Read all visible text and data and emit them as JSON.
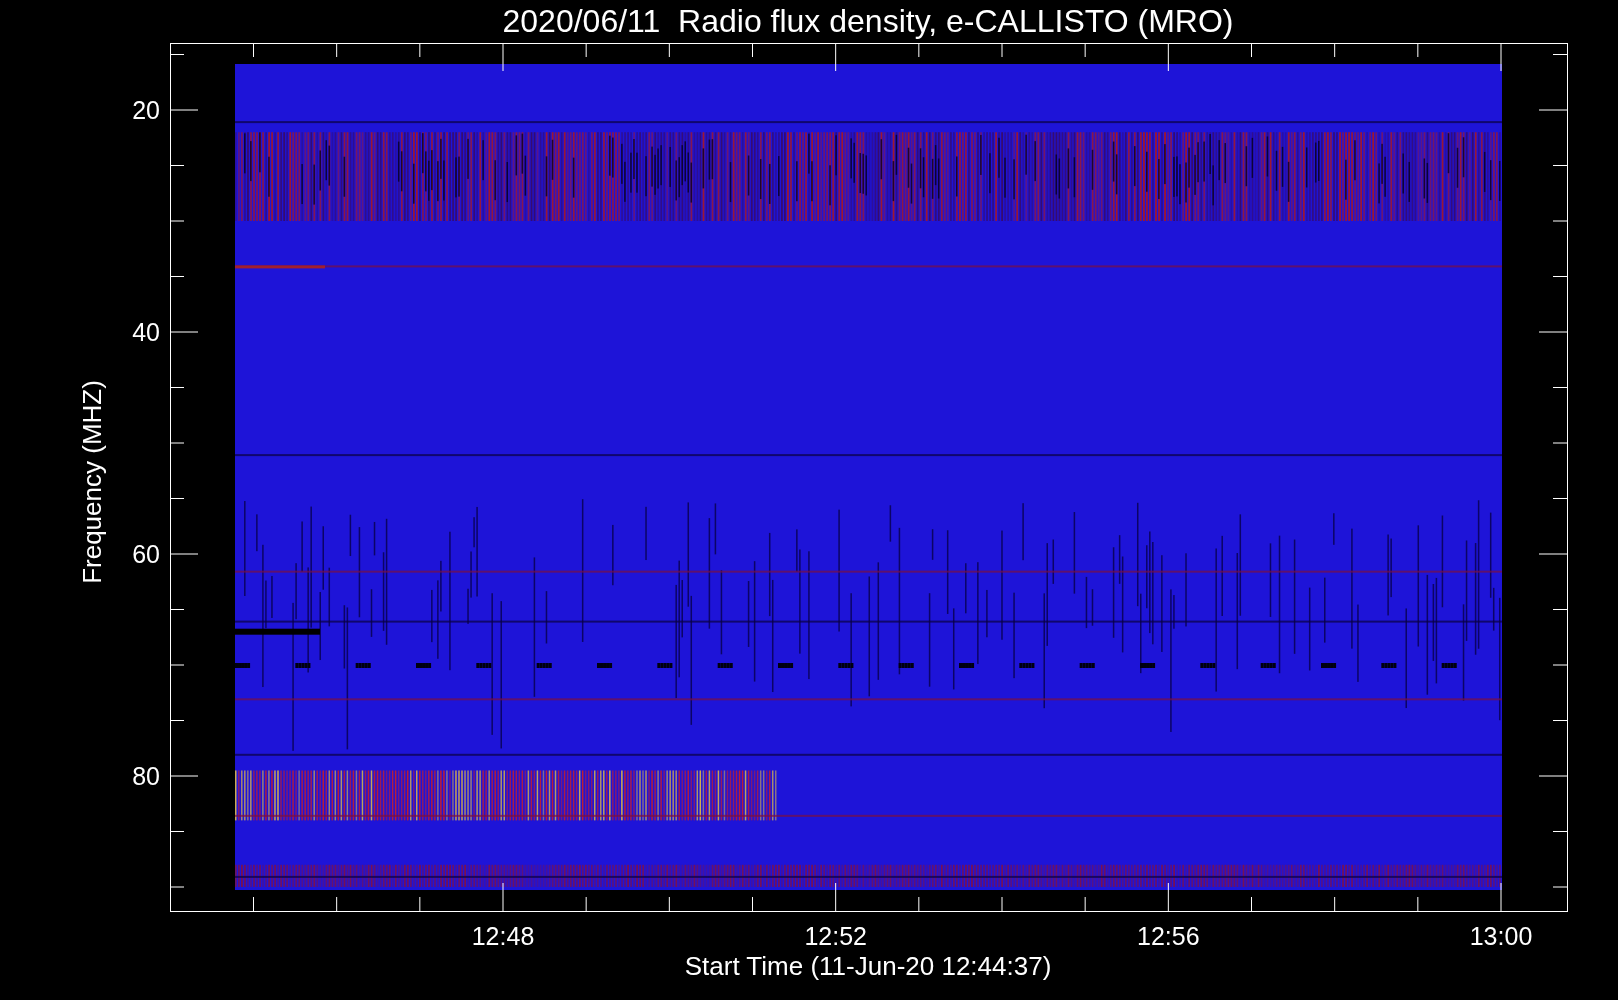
{
  "title": "2020/06/11  Radio flux density, e-CALLISTO (MRO)",
  "y_axis": {
    "label": "Frequency (MHZ)",
    "ticks": [
      "20",
      "40",
      "60",
      "80"
    ]
  },
  "x_axis": {
    "label": "Start Time (11-Jun-20 12:44:37)",
    "ticks": [
      "12:48",
      "12:52",
      "12:56",
      "13:00"
    ]
  }
}
